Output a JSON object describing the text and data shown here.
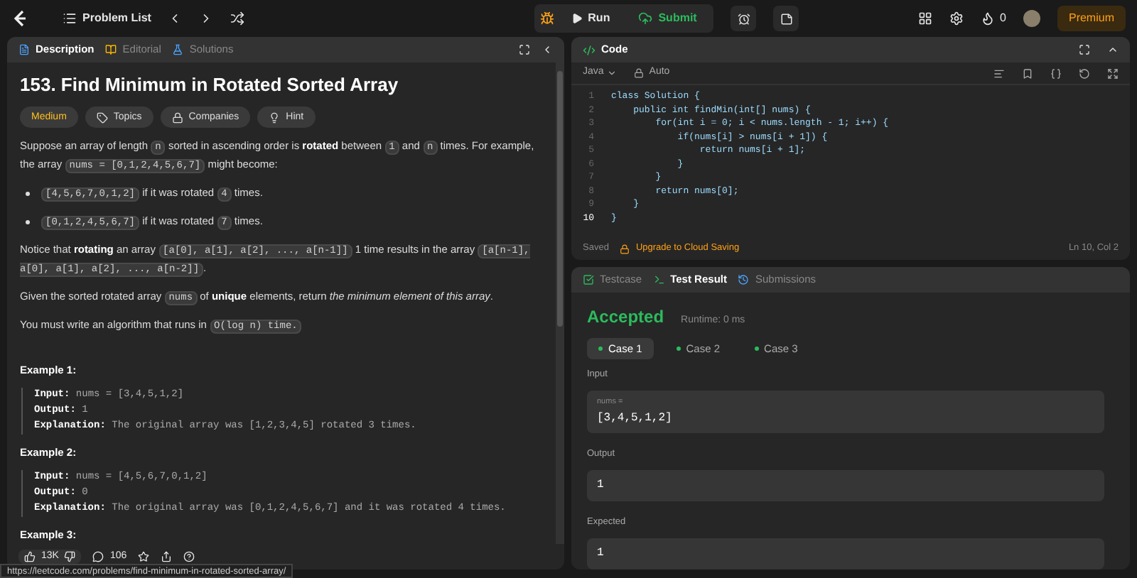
{
  "nav": {
    "problem_list": "Problem List",
    "run": "Run",
    "submit": "Submit",
    "streak": "0",
    "premium": "Premium"
  },
  "description": {
    "tabs": [
      {
        "label": "Description",
        "selected": true
      },
      {
        "label": "Editorial",
        "selected": false
      },
      {
        "label": "Solutions",
        "selected": false
      }
    ],
    "title": "153. Find Minimum in Rotated Sorted Array",
    "tags": [
      {
        "label": "Medium",
        "kind": "difficulty"
      },
      {
        "label": "Topics",
        "kind": "topics"
      },
      {
        "label": "Companies",
        "kind": "companies"
      },
      {
        "label": "Hint",
        "kind": "hint"
      }
    ],
    "paragraphs": [
      {
        "kind": "para",
        "segments": [
          {
            "kind": "text",
            "text": "Suppose an array of length "
          },
          {
            "kind": "code",
            "text": "n"
          },
          {
            "kind": "text",
            "text": " sorted in ascending order is "
          },
          {
            "kind": "bold",
            "text": "rotated"
          },
          {
            "kind": "text",
            "text": " between "
          },
          {
            "kind": "code",
            "text": "1"
          },
          {
            "kind": "text",
            "text": " and "
          },
          {
            "kind": "code",
            "text": "n"
          },
          {
            "kind": "text",
            "text": " times. For example, the array "
          },
          {
            "kind": "code",
            "text": "nums = [0,1,2,4,5,6,7]"
          },
          {
            "kind": "text",
            "text": " might become:"
          }
        ]
      },
      {
        "kind": "bullet",
        "segments": [
          {
            "kind": "code",
            "text": "[4,5,6,7,0,1,2]"
          },
          {
            "kind": "text",
            "text": " if it was rotated "
          },
          {
            "kind": "code",
            "text": "4"
          },
          {
            "kind": "text",
            "text": " times."
          }
        ]
      },
      {
        "kind": "bullet",
        "segments": [
          {
            "kind": "code",
            "text": "[0,1,2,4,5,6,7]"
          },
          {
            "kind": "text",
            "text": " if it was rotated "
          },
          {
            "kind": "code",
            "text": "7"
          },
          {
            "kind": "text",
            "text": " times."
          }
        ]
      },
      {
        "kind": "para",
        "segments": [
          {
            "kind": "text",
            "text": "Notice that "
          },
          {
            "kind": "bold",
            "text": "rotating"
          },
          {
            "kind": "text",
            "text": " an array "
          },
          {
            "kind": "code",
            "text": "[a[0], a[1], a[2], ..., a[n-1]]"
          },
          {
            "kind": "text",
            "text": " 1 time results in the array "
          },
          {
            "kind": "code",
            "text": "[a[n-1], a[0], a[1], a[2], ..., a[n-2]]"
          },
          {
            "kind": "text",
            "text": "."
          }
        ]
      },
      {
        "kind": "para",
        "segments": [
          {
            "kind": "text",
            "text": "Given the sorted rotated array "
          },
          {
            "kind": "code",
            "text": "nums"
          },
          {
            "kind": "text",
            "text": " of "
          },
          {
            "kind": "bold",
            "text": "unique"
          },
          {
            "kind": "text",
            "text": " elements, return "
          },
          {
            "kind": "italic",
            "text": "the minimum element of this array"
          },
          {
            "kind": "text",
            "text": "."
          }
        ]
      },
      {
        "kind": "para",
        "segments": [
          {
            "kind": "text",
            "text": "You must write an algorithm that runs in "
          },
          {
            "kind": "code",
            "text": "O(log n) time."
          }
        ]
      }
    ],
    "examples": [
      {
        "title": "Example 1:",
        "lines": [
          {
            "label": "Input:",
            "value": "nums = [3,4,5,1,2]"
          },
          {
            "label": "Output:",
            "value": "1"
          },
          {
            "label": "Explanation:",
            "value": "The original array was [1,2,3,4,5] rotated 3 times."
          }
        ]
      },
      {
        "title": "Example 2:",
        "lines": [
          {
            "label": "Input:",
            "value": "nums = [4,5,6,7,0,1,2]"
          },
          {
            "label": "Output:",
            "value": "0"
          },
          {
            "label": "Explanation:",
            "value": "The original array was [0,1,2,4,5,6,7] and it was rotated 4 times."
          }
        ]
      },
      {
        "title": "Example 3:"
      }
    ],
    "likes": "13K",
    "comments": "106"
  },
  "code": {
    "title": "Code",
    "language": "Java",
    "mode": "Auto",
    "lines": [
      {
        "num": "1",
        "text": "class Solution {",
        "current": false
      },
      {
        "num": "2",
        "text": "    public int findMin(int[] nums) {",
        "current": false
      },
      {
        "num": "3",
        "text": "        for(int i = 0; i < nums.length - 1; i++) {",
        "current": false
      },
      {
        "num": "4",
        "text": "            if(nums[i] > nums[i + 1]) {",
        "current": false
      },
      {
        "num": "5",
        "text": "                return nums[i + 1];",
        "current": false
      },
      {
        "num": "6",
        "text": "            }",
        "current": false
      },
      {
        "num": "7",
        "text": "        }",
        "current": false
      },
      {
        "num": "8",
        "text": "        return nums[0];",
        "current": false
      },
      {
        "num": "9",
        "text": "    }",
        "current": false
      },
      {
        "num": "10",
        "text": "}",
        "current": true
      }
    ],
    "saved": "Saved",
    "upgrade": "Upgrade to Cloud Saving",
    "cursor": "Ln 10, Col 2"
  },
  "result": {
    "tabs": [
      {
        "label": "Testcase",
        "selected": false
      },
      {
        "label": "Test Result",
        "selected": true
      },
      {
        "label": "Submissions",
        "selected": false
      }
    ],
    "status": "Accepted",
    "runtime": "Runtime: 0 ms",
    "cases": [
      {
        "label": "Case 1",
        "selected": true
      },
      {
        "label": "Case 2",
        "selected": false
      },
      {
        "label": "Case 3",
        "selected": false
      }
    ],
    "input_label": "Input",
    "input_var": "nums =",
    "input_value": "[3,4,5,1,2]",
    "output_label": "Output",
    "output_value": "1",
    "expected_label": "Expected",
    "expected_value": "1"
  },
  "status_url": "https://leetcode.com/problems/find-minimum-in-rotated-sorted-array/"
}
